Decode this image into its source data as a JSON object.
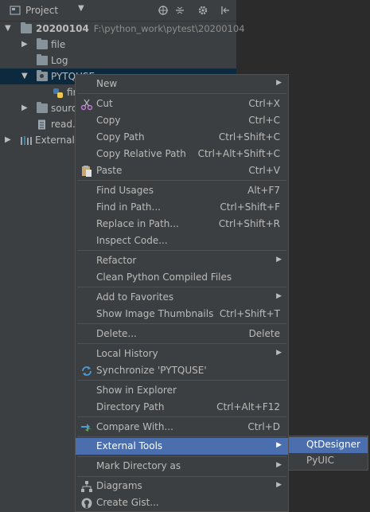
{
  "panel": {
    "title": "Project",
    "tree": [
      {
        "label": "20200104",
        "path": "F:\\python_work\\pytest\\20200104"
      },
      {
        "label": "file"
      },
      {
        "label": "Log"
      },
      {
        "label": "PYTQUSE"
      },
      {
        "label": "fir"
      },
      {
        "label": "source"
      },
      {
        "label": "read.tx"
      },
      {
        "label": "External Li"
      }
    ]
  },
  "menu": {
    "items": [
      {
        "label": "New",
        "shortcut": ""
      },
      {
        "label": "Cut",
        "shortcut": "Ctrl+X"
      },
      {
        "label": "Copy",
        "shortcut": "Ctrl+C"
      },
      {
        "label": "Copy Path",
        "shortcut": "Ctrl+Shift+C"
      },
      {
        "label": "Copy Relative Path",
        "shortcut": "Ctrl+Alt+Shift+C"
      },
      {
        "label": "Paste",
        "shortcut": "Ctrl+V"
      },
      {
        "label": "Find Usages",
        "shortcut": "Alt+F7"
      },
      {
        "label": "Find in Path...",
        "shortcut": "Ctrl+Shift+F"
      },
      {
        "label": "Replace in Path...",
        "shortcut": "Ctrl+Shift+R"
      },
      {
        "label": "Inspect Code...",
        "shortcut": ""
      },
      {
        "label": "Refactor",
        "shortcut": ""
      },
      {
        "label": "Clean Python Compiled Files",
        "shortcut": ""
      },
      {
        "label": "Add to Favorites",
        "shortcut": ""
      },
      {
        "label": "Show Image Thumbnails",
        "shortcut": "Ctrl+Shift+T"
      },
      {
        "label": "Delete...",
        "shortcut": "Delete"
      },
      {
        "label": "Local History",
        "shortcut": ""
      },
      {
        "label": "Synchronize 'PYTQUSE'",
        "shortcut": ""
      },
      {
        "label": "Show in Explorer",
        "shortcut": ""
      },
      {
        "label": "Directory Path",
        "shortcut": "Ctrl+Alt+F12"
      },
      {
        "label": "Compare With...",
        "shortcut": "Ctrl+D"
      },
      {
        "label": "External Tools",
        "shortcut": ""
      },
      {
        "label": "Mark Directory as",
        "shortcut": ""
      },
      {
        "label": "Diagrams",
        "shortcut": ""
      },
      {
        "label": "Create Gist...",
        "shortcut": ""
      }
    ],
    "submenu_arrow": "▶"
  },
  "submenu": {
    "items": [
      {
        "label": "QtDesigner"
      },
      {
        "label": "PyUIC"
      }
    ]
  },
  "colors": {
    "highlight": "#4b6eaf",
    "panel_bg": "#3c3f41",
    "editor_bg": "#2b2b2b",
    "selected_row": "#0d293e"
  }
}
